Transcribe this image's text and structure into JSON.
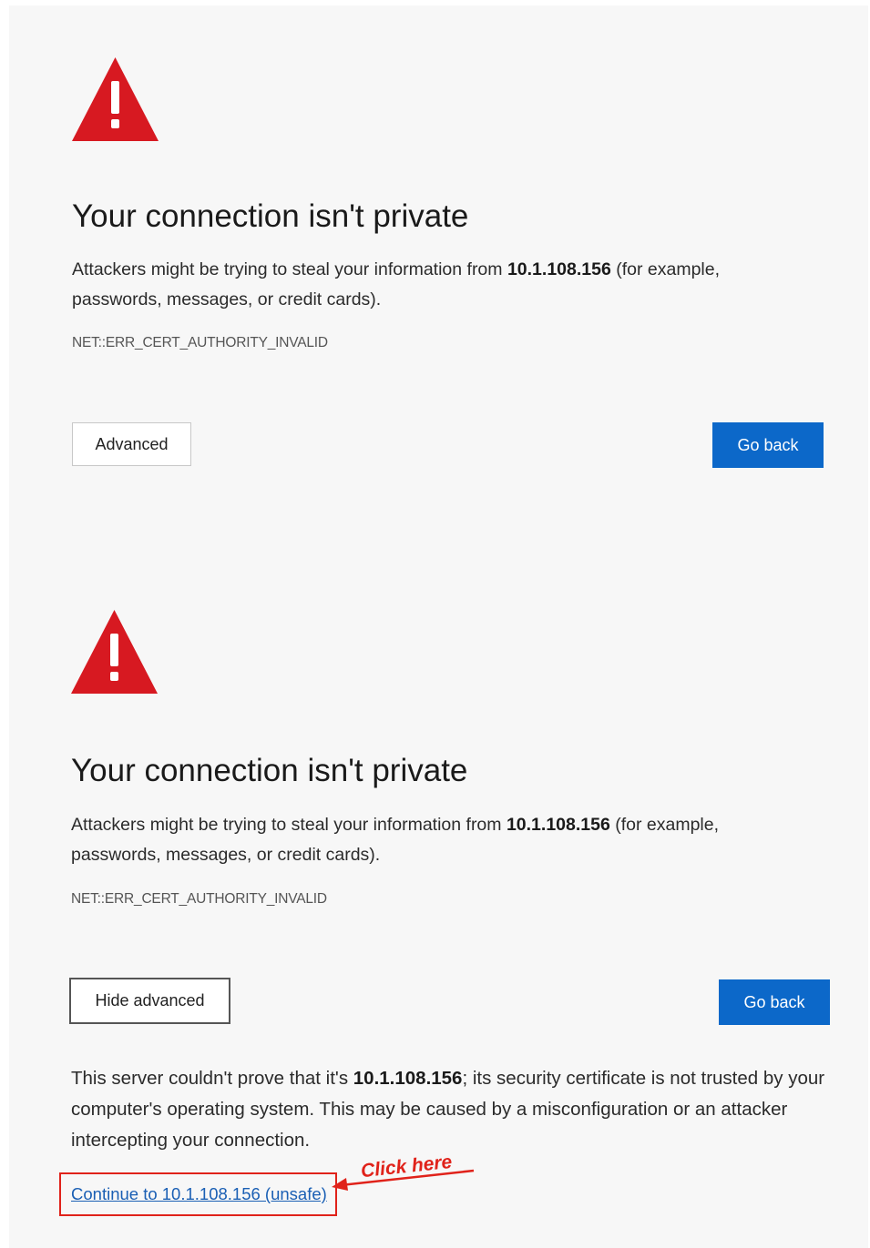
{
  "first_view": {
    "title": "Your connection isn't private",
    "description_prefix": "Attackers might be trying to steal your information from ",
    "host": "10.1.108.156",
    "description_suffix": " (for example, passwords, messages, or credit cards).",
    "error_code": "NET::ERR_CERT_AUTHORITY_INVALID",
    "advanced_label": "Advanced",
    "go_back_label": "Go back"
  },
  "second_view": {
    "title": "Your connection isn't private",
    "description_prefix": "Attackers might be trying to steal your information from ",
    "host": "10.1.108.156",
    "description_suffix": " (for example, passwords, messages, or credit cards).",
    "error_code": "NET::ERR_CERT_AUTHORITY_INVALID",
    "hide_advanced_label": "Hide advanced",
    "go_back_label": "Go back",
    "advanced_prefix": "This server couldn't prove that it's ",
    "advanced_host": "10.1.108.156",
    "advanced_suffix": "; its security certificate is not trusted by your computer's operating system. This may be caused by a misconfiguration or an attacker intercepting your connection.",
    "proceed_link": "Continue to 10.1.108.156 (unsafe)"
  },
  "annotation": {
    "text": "Click here"
  },
  "colors": {
    "warning_red": "#d71921",
    "primary_blue": "#0c68c9",
    "annotation_red": "#e0221a"
  },
  "icons": {
    "warning": "warning-triangle-icon"
  }
}
